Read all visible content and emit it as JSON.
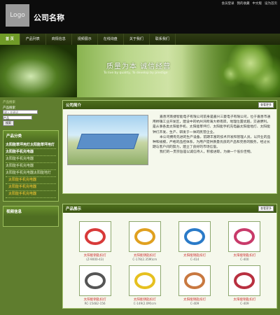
{
  "header": {
    "logo_text": "Logo",
    "company_name": "公司名称",
    "top_links": [
      "会员登录",
      "我的收藏",
      "中文版",
      "设为首页"
    ]
  },
  "nav": {
    "items": [
      "首 页",
      "产品列表",
      "商情信息",
      "视频展示",
      "在线询盘",
      "关于我们",
      "联系我们"
    ]
  },
  "banner": {
    "slogan": "质量为本  诚信经营",
    "slogan_en": "To live by quality, To develop by prestige"
  },
  "sidebar": {
    "search_title": "产品搜索",
    "search_label": "产品搜索",
    "search_placeholder": "输入关键词",
    "search_select": "产品",
    "search_button": "搜索",
    "category_title": "产品分类",
    "categories": [
      {
        "label": "太阳能草坪用灯太阳能草坪用灯",
        "type": "bold"
      },
      {
        "label": "太阳能手机充电器",
        "type": "bold"
      },
      {
        "label": "太阳能手机充电器",
        "type": "plain"
      },
      {
        "label": "太阳能手机充电器",
        "type": "plain"
      },
      {
        "label": "太阳能手机充电器太阳能地灯",
        "type": "plain"
      },
      {
        "label": "太阳能手机充电器",
        "type": "sub"
      },
      {
        "label": "太阳能手机充电器",
        "type": "sub"
      },
      {
        "label": "太阳能手机充电器",
        "type": "sub"
      }
    ],
    "video_title": "视频信息"
  },
  "about": {
    "title": "公司简介",
    "more": "查看更多",
    "paragraph1": "嘉善河南捷智能电子有限公司前身是嘉兴三菱电子有限公司，位于嘉善市通用桥镇工业开发区，建设中的杭州湾跨海大桥南岸，地理位置优越，交通便利。是从事各类太阳能手机、太阳能草坪灯、太阳能手机充电器太阳能地灯、太阳能钟灯开发、生产、研发于一体的民营企业。",
    "paragraph2": "本公司拥有先进的生产设备，前期丰富的技术开发和管理人员，以开业的品种和规模，严格的品控体系，为用户提供质量优良的产品和完善的服务。经过长期与客户间的努力，建立了良好的市场信誉。",
    "paragraph3": "我们的一贯宗旨是以诚信待人，积极进取，为做一个低价佳物。"
  },
  "products": {
    "title": "产品展示",
    "more": "查看更多",
    "items": [
      {
        "name": "太阳能钥匙扣灯",
        "code": "(Z-9000-43)",
        "color": "#d83a3a"
      },
      {
        "name": "太阳能钥匙扣灯",
        "code": "C-178(2.35M)cm",
        "color": "#e0a020"
      },
      {
        "name": "太阳能钥匙扣灯",
        "code": "C-414",
        "color": "#2a7ac8"
      },
      {
        "name": "太阳能钥匙扣灯",
        "code": "C-400",
        "color": "#c83a6a"
      },
      {
        "name": "太阳能钥匙扣灯",
        "code": "RC-15482-156",
        "color": "#555555"
      },
      {
        "name": "太阳能钥匙扣灯",
        "code": "C-149(2.0M)cm",
        "color": "#e6c020"
      },
      {
        "name": "太阳能钥匙扣灯",
        "code": "C-409",
        "color": "#c87840"
      },
      {
        "name": "太阳能钥匙扣灯",
        "code": "C-409",
        "color": "#b83040"
      }
    ]
  }
}
